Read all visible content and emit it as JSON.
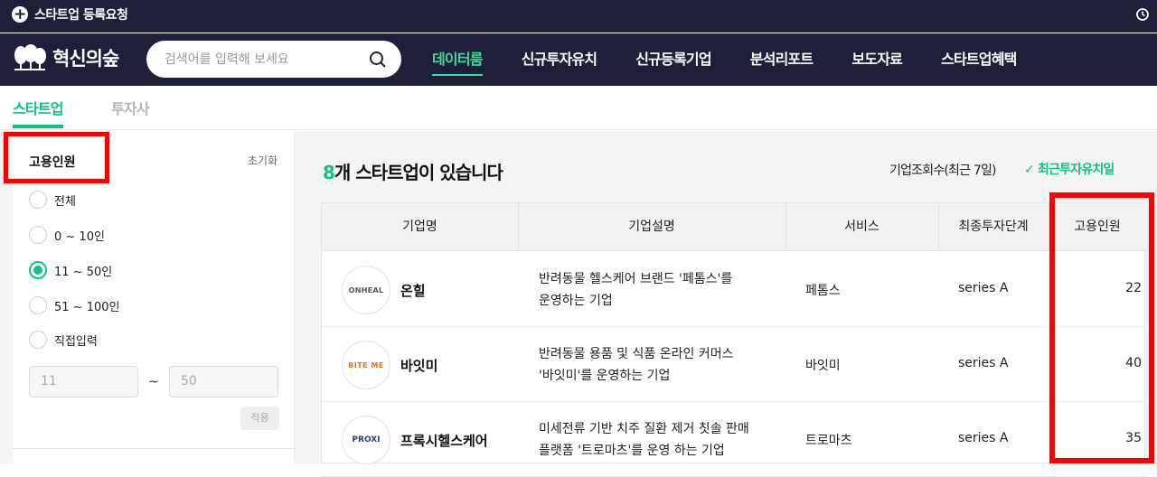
{
  "topbar": {
    "register_label": "스타트업 등록요청"
  },
  "nav": {
    "logo_text": "혁신의숲",
    "search_placeholder": "검색어를 입력해 보세요",
    "menu": [
      "데이터룸",
      "신규투자유치",
      "신규등록기업",
      "분석리포트",
      "보도자료",
      "스타트업혜택"
    ]
  },
  "tabs": [
    "스타트업",
    "투자사"
  ],
  "filter": {
    "title": "고용인원",
    "reset_label": "초기화",
    "options": [
      "전체",
      "0 ~ 10인",
      "11 ~ 50인",
      "51 ~ 100인",
      "직접입력"
    ],
    "selected_index": 2,
    "min_value": "11",
    "max_value": "50",
    "tilde": "~",
    "apply_label": "적용"
  },
  "results": {
    "count_number": "8",
    "count_suffix": "개 스타트업이 있습니다",
    "sort_views": "기업조회수(최근 7일)",
    "sort_latest": "최근투자유치일"
  },
  "table": {
    "headers": [
      "기업명",
      "기업설명",
      "서비스",
      "최종투자단계",
      "고용인원"
    ],
    "rows": [
      {
        "logo": "ONHEAL",
        "name": "온힐",
        "desc_1": "반려동물 헬스케어 브랜드 '페톰스'를",
        "desc_2": "운영하는 기업",
        "service": "페톰스",
        "stage": "series A",
        "employees": "22"
      },
      {
        "logo": "BITE ME",
        "name": "바잇미",
        "desc_1": "반려동물 용품 및 식품 온라인 커머스",
        "desc_2": "'바잇미'를 운영하는 기업",
        "service": "바잇미",
        "stage": "series A",
        "employees": "40"
      },
      {
        "logo": "PROXI",
        "name": "프록시헬스케어",
        "desc_1": "미세전류 기반 치주 질환 제거 칫솔 판매",
        "desc_2": "플랫폼 '트로마츠'를 운영 하는 기업",
        "service": "트로마츠",
        "stage": "series A",
        "employees": "35"
      }
    ]
  }
}
